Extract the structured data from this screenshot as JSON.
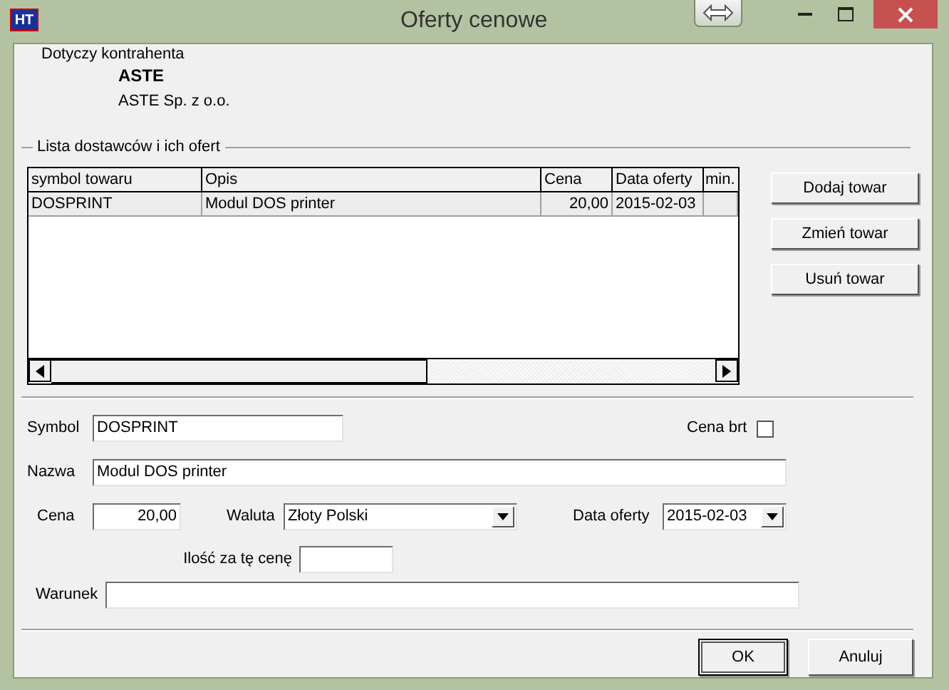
{
  "window": {
    "icon_text": "HT",
    "title": "Oferty cenowe"
  },
  "contractor": {
    "label": "Dotyczy kontrahenta",
    "code": "ASTE",
    "name": "ASTE Sp. z o.o."
  },
  "offers": {
    "title": "Lista dostawców i ich ofert",
    "columns": [
      "symbol towaru",
      "Opis",
      "Cena",
      "Data oferty",
      "min."
    ],
    "rows": [
      {
        "symbol": "DOSPRINT",
        "opis": "Modul DOS printer",
        "cena": "20,00",
        "data": "2015-02-03",
        "selected": true
      }
    ],
    "buttons": [
      "Dodaj towar",
      "Zmień towar",
      "Usuń towar"
    ]
  },
  "form": {
    "symbol": {
      "label": "Symbol",
      "value": "DOSPRINT"
    },
    "cena_brt": {
      "label": "Cena brt",
      "checked": false
    },
    "nazwa": {
      "label": "Nazwa",
      "value": "Modul DOS printer"
    },
    "cena": {
      "label": "Cena",
      "value": "20,00"
    },
    "waluta": {
      "label": "Waluta",
      "value": "Złoty Polski"
    },
    "data_oferty": {
      "label": "Data oferty",
      "value": "2015-02-03"
    },
    "ilosc": {
      "label": "Ilość za tę cenę"
    },
    "warunek": {
      "label": "Warunek"
    }
  },
  "dialog_buttons": [
    "OK",
    "Anuluj"
  ]
}
